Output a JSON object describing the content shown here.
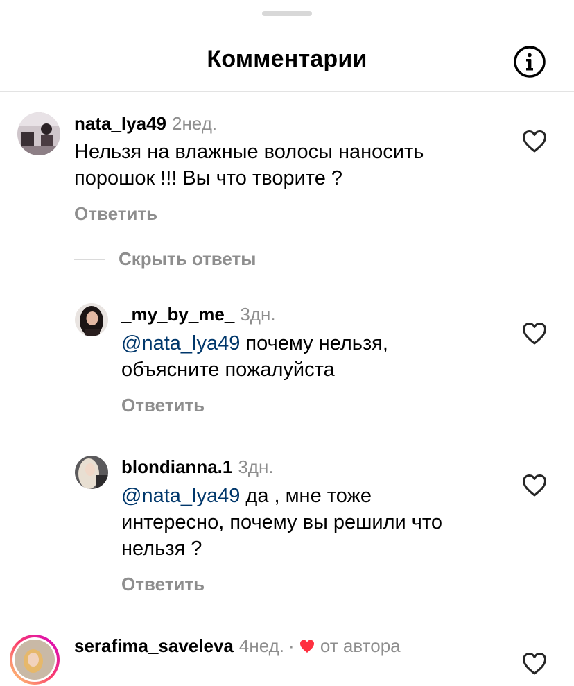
{
  "header": {
    "title": "Комментарии"
  },
  "comments": [
    {
      "username": "nata_lya49",
      "time": "2нед.",
      "text_line1": "Нельзя на влажные волосы наносить",
      "text_line2": "порошок !!! Вы что творите ?",
      "reply_label": "Ответить",
      "hide_replies_label": "Скрыть ответы",
      "replies": [
        {
          "username": "_my_by_me_",
          "time": "3дн.",
          "mention": "@nata_lya49",
          "text_line1": " почему нельзя,",
          "text_line2": "объясните пожалуйста",
          "reply_label": "Ответить"
        },
        {
          "username": "blondianna.1",
          "time": "3дн.",
          "mention": "@nata_lya49",
          "text_line1": " да , мне тоже",
          "text_line2": "интересно, почему вы решили что",
          "text_line3": "нельзя ?",
          "reply_label": "Ответить"
        }
      ]
    },
    {
      "username": "serafima_saveleva",
      "time": "4нед.",
      "separator": "·",
      "author_like_label": "от автора"
    }
  ],
  "icons": {
    "info": "info-icon",
    "like": "heart-outline-icon",
    "liked_by_author": "heart-filled-icon"
  },
  "colors": {
    "mention": "#00376b",
    "secondary_text": "#8e8e8e",
    "author_heart": "#ff3040",
    "story_ring": "#d300c5"
  }
}
